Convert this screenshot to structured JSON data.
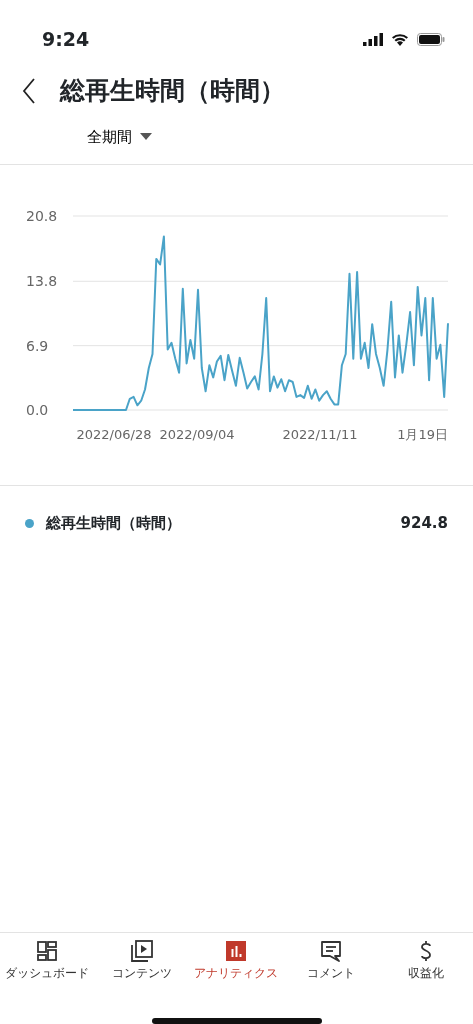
{
  "status_bar": {
    "time": "9:24"
  },
  "header": {
    "title": "総再生時間（時間）",
    "period": "全期間"
  },
  "chart_data": {
    "type": "line",
    "ylim": [
      0,
      20.8
    ],
    "yticks": [
      {
        "value": 0,
        "label": "0.0"
      },
      {
        "value": 6.9,
        "label": "6.9"
      },
      {
        "value": 13.8,
        "label": "13.8"
      },
      {
        "value": 20.8,
        "label": "20.8"
      }
    ],
    "series": [
      {
        "name": "総再生時間（時間）",
        "color": "#4aa3c8",
        "values": [
          0,
          0,
          0,
          0,
          0,
          0,
          0,
          0,
          0,
          0,
          0,
          0,
          0,
          0,
          0,
          1.2,
          1.4,
          0.5,
          1.0,
          2.2,
          4.5,
          6.0,
          16.2,
          15.6,
          18.6,
          6.5,
          7.2,
          5.5,
          4.0,
          13.0,
          5.0,
          7.5,
          5.5,
          12.9,
          4.5,
          2.0,
          4.8,
          3.5,
          5.2,
          5.8,
          3.2,
          5.9,
          4.2,
          2.6,
          5.6,
          4.0,
          2.3,
          3.0,
          3.6,
          2.2,
          6.0,
          12.0,
          2.0,
          3.6,
          2.4,
          3.3,
          2.0,
          3.2,
          3.0,
          1.4,
          1.6,
          1.3,
          2.6,
          1.2,
          2.2,
          1.0,
          1.6,
          2.0,
          1.2,
          0.6,
          0.6,
          4.8,
          6.0,
          14.6,
          5.5,
          14.8,
          5.5,
          7.2,
          4.5,
          9.2,
          6.0,
          4.5,
          2.6,
          6.4,
          11.6,
          3.5,
          8.0,
          4.0,
          7.0,
          10.5,
          4.8,
          13.2,
          8.0,
          12.0,
          3.2,
          12.0,
          5.5,
          7.0,
          1.4,
          9.3
        ]
      }
    ]
  },
  "x_axis_labels": [
    "2022/06/28",
    "2022/09/04",
    "2022/11/11",
    "1月19日"
  ],
  "legend": [
    {
      "value": "924.8"
    }
  ],
  "nav": [
    {
      "kind": "dashboard",
      "label": "ダッシュボード",
      "selected": false
    },
    {
      "kind": "content",
      "label": "コンテンツ",
      "selected": false
    },
    {
      "kind": "analytics",
      "label": "アナリティクス",
      "selected": true
    },
    {
      "kind": "comments",
      "label": "コメント",
      "selected": false
    },
    {
      "kind": "earn",
      "label": "収益化",
      "selected": false
    }
  ]
}
